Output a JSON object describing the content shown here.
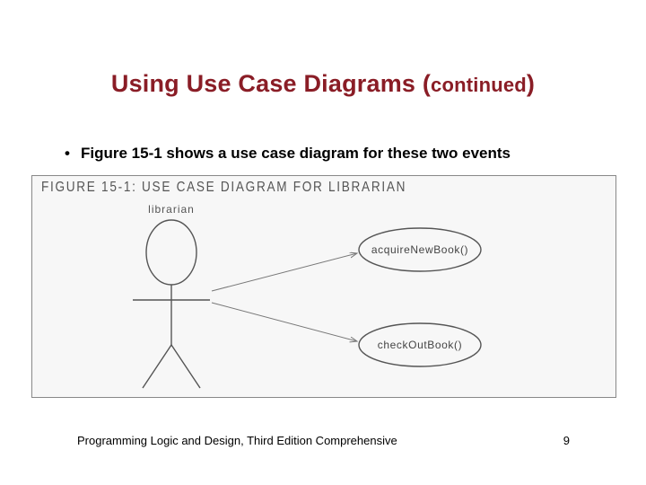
{
  "title": {
    "main": "Using Use Case Diagrams (",
    "sub": "continued",
    "close": ")"
  },
  "bullet": "Figure 15-1 shows a use case diagram for these two events",
  "figure": {
    "caption": "FIGURE 15-1: USE CASE DIAGRAM FOR LIBRARIAN",
    "actor_label": "librarian",
    "usecase1": "acquireNewBook()",
    "usecase2": "checkOutBook()"
  },
  "footer": {
    "left": "Programming Logic and Design, Third Edition Comprehensive",
    "page": "9"
  }
}
